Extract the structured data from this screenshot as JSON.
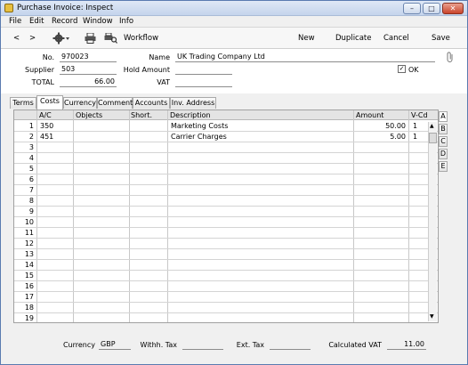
{
  "window": {
    "title": "Purchase Invoice: Inspect",
    "minimize": "–",
    "maximize": "□",
    "close": "✕"
  },
  "menu": [
    "File",
    "Edit",
    "Record",
    "Window",
    "Info"
  ],
  "toolbar": {
    "back": "<",
    "forward": ">",
    "workflow": "Workflow",
    "new": "New",
    "duplicate": "Duplicate",
    "cancel": "Cancel",
    "save": "Save"
  },
  "header": {
    "no_label": "No.",
    "no_value": "970023",
    "name_label": "Name",
    "name_value": "UK Trading Company Ltd",
    "supplier_label": "Supplier",
    "supplier_value": "503",
    "hold_label": "Hold Amount",
    "hold_value": "",
    "ok_label": "OK",
    "ok_checked": true,
    "total_label": "TOTAL",
    "total_value": "66.00",
    "vat_label": "VAT",
    "vat_value": ""
  },
  "tabs": [
    "Terms",
    "Costs",
    "Currency",
    "Comment",
    "Accounts",
    "Inv. Address"
  ],
  "active_tab": "Costs",
  "grid": {
    "columns": [
      "A/C",
      "Objects",
      "Short.",
      "Description",
      "Amount",
      "V-Cd"
    ],
    "rows": [
      {
        "n": "1",
        "ac": "350",
        "objects": "",
        "short": "",
        "desc": "Marketing Costs",
        "amount": "50.00",
        "vcd": "1"
      },
      {
        "n": "2",
        "ac": "451",
        "objects": "",
        "short": "",
        "desc": "Carrier Charges",
        "amount": "5.00",
        "vcd": "1"
      },
      {
        "n": "3"
      },
      {
        "n": "4"
      },
      {
        "n": "5"
      },
      {
        "n": "6"
      },
      {
        "n": "7"
      },
      {
        "n": "8"
      },
      {
        "n": "9"
      },
      {
        "n": "10"
      },
      {
        "n": "11"
      },
      {
        "n": "12"
      },
      {
        "n": "13"
      },
      {
        "n": "14"
      },
      {
        "n": "15"
      },
      {
        "n": "16"
      },
      {
        "n": "17"
      },
      {
        "n": "18"
      },
      {
        "n": "19"
      }
    ]
  },
  "side_tabs": [
    "A",
    "B",
    "C",
    "D",
    "E"
  ],
  "active_side_tab": "A",
  "footer": {
    "currency_label": "Currency",
    "currency_value": "GBP",
    "withh_label": "Withh. Tax",
    "withh_value": "",
    "ext_label": "Ext. Tax",
    "ext_value": "",
    "calc_vat_label": "Calculated VAT",
    "calc_vat_value": "11.00"
  }
}
